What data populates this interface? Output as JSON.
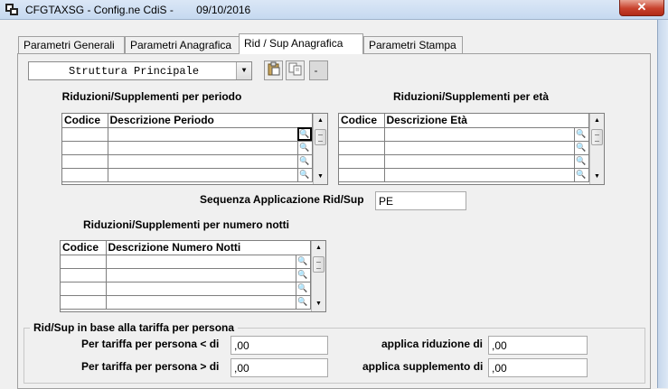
{
  "window": {
    "title": "CFGTAXSG - Config.ne CdiS",
    "date": "09/10/2016",
    "close_label": "✕"
  },
  "tabs": [
    {
      "label": "Parametri Generali",
      "active": false
    },
    {
      "label": "Parametri Anagrafica",
      "active": false
    },
    {
      "label": "Rid / Sup Anagrafica",
      "active": true
    },
    {
      "label": "Parametri Stampa",
      "active": false
    }
  ],
  "structure_select": {
    "value": "Struttura Principale"
  },
  "toolbar": {
    "paste_icon": "clipboard-icon",
    "copy_icon": "copy-icon",
    "blank_icon": "blank-button-icon"
  },
  "period_grid": {
    "title": "Riduzioni/Supplementi per periodo",
    "columns": [
      "Codice",
      "Descrizione Periodo"
    ]
  },
  "age_grid": {
    "title": "Riduzioni/Supplementi per età",
    "columns": [
      "Codice",
      "Descrizione Età"
    ]
  },
  "sequence": {
    "label": "Sequenza Applicazione Rid/Sup",
    "value": "PE"
  },
  "nights_grid": {
    "title": "Riduzioni/Supplementi per numero notti",
    "columns": [
      "Codice",
      "Descrizione Numero Notti"
    ]
  },
  "person_rate": {
    "legend": "Rid/Sup in base alla tariffa per persona",
    "less_label": "Per tariffa per persona < di",
    "less_value": ",00",
    "greater_label": "Per tariffa per persona > di",
    "greater_value": ",00",
    "reduction_label": "applica riduzione di",
    "reduction_value": ",00",
    "supplement_label": "applica supplemento di",
    "supplement_value": ",00"
  },
  "icons": {
    "lookup": "magnifier-icon",
    "scroll_up": "▲",
    "scroll_down": "▼",
    "combo_arrow": "▼"
  }
}
